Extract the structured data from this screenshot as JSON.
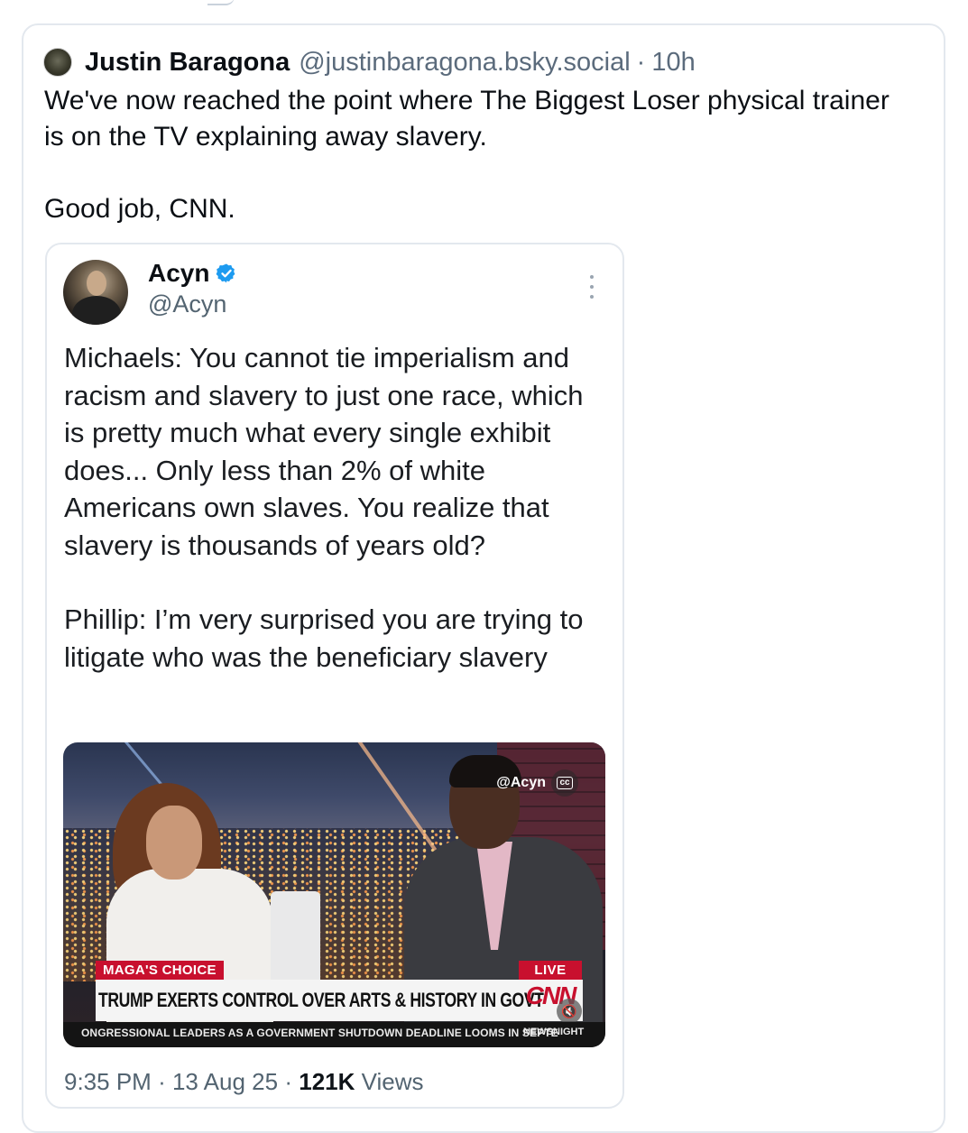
{
  "post": {
    "author_name": "Justin Baragona",
    "author_handle": "@justinbaragona.bsky.social",
    "separator": "·",
    "time": "10h",
    "text_line1": "We've now reached the point where The Biggest Loser physical trainer is on the TV explaining away slavery.",
    "text_line2": "Good job, CNN."
  },
  "quoted": {
    "name": "Acyn",
    "handle": "@Acyn",
    "paragraph1": "Michaels: You cannot tie imperialism and racism and slavery to just one race, which is pretty much what every single exhibit does... Only less than 2% of white Americans own slaves. You realize that slavery is thousands of years old?",
    "paragraph2": "Phillip: I’m very surprised you are trying to litigate who was the beneficiary slavery",
    "media": {
      "watermark": "@Acyn",
      "cc_label": "cc",
      "tag_left": "MAGA'S CHOICE",
      "tag_right": "LIVE",
      "headline": "TRUMP EXERTS CONTROL OVER ARTS & HISTORY IN GOVT",
      "logo": "CNN",
      "ticker": "ONGRESSIONAL LEADERS AS A GOVERNMENT SHUTDOWN DEADLINE LOOMS IN SEPTE",
      "ticker_right": "NEWSNIGHT",
      "mute_symbol": "🔇"
    },
    "footer": {
      "time": "9:35 PM",
      "dot": "·",
      "date": "13 Aug 25",
      "views_count": "121K",
      "views_label": "Views"
    }
  },
  "icons": {
    "verified": "verified-badge-icon",
    "more": "more-options-icon",
    "mute": "mute-icon",
    "cc": "closed-captions-icon"
  },
  "colors": {
    "verified_blue": "#1d9bf0",
    "cnn_red": "#c8102e",
    "muted_text": "#536471"
  }
}
